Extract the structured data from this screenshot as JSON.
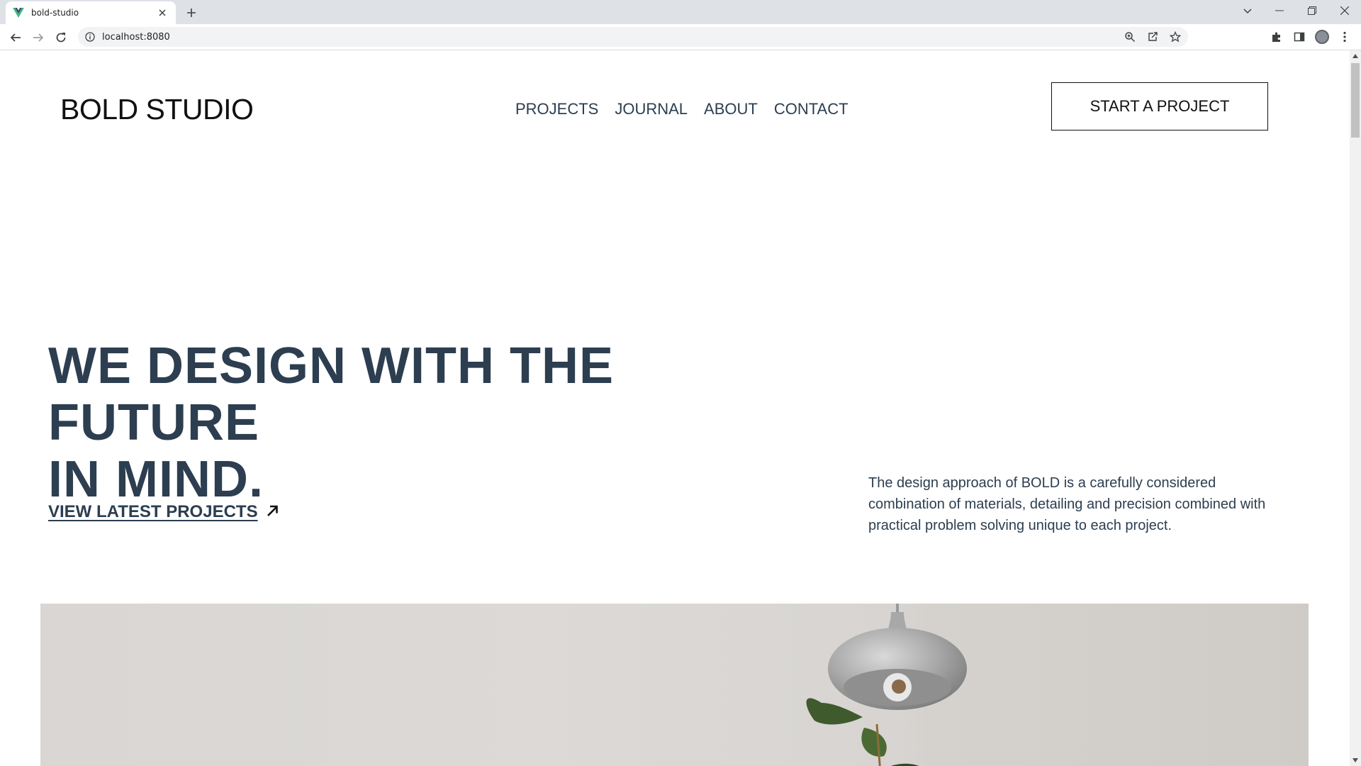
{
  "browser": {
    "tab_title": "bold-studio",
    "url": "localhost:8080",
    "icons": [
      "vue-favicon",
      "close-icon",
      "plus-icon",
      "chevron-down-icon",
      "minimize-icon",
      "restore-icon",
      "back-arrow-icon",
      "forward-arrow-icon",
      "reload-icon",
      "info-icon",
      "zoom-icon",
      "share-icon",
      "star-icon",
      "extensions-icon",
      "sidepanel-icon",
      "profile-avatar",
      "kebab-menu-icon"
    ]
  },
  "site": {
    "logo": "BOLD STUDIO",
    "nav": [
      "PROJECTS",
      "JOURNAL",
      "ABOUT",
      "CONTACT"
    ],
    "cta_label": "START A PROJECT"
  },
  "hero": {
    "title_line1": "WE DESIGN WITH THE FUTURE",
    "title_line2": "IN MIND.",
    "link_label": "VIEW LATEST PROJECTS",
    "description": "The design approach of BOLD is a carefully considered combination of materials, detailing and precision combined with practical problem solving unique to each project."
  },
  "colors": {
    "text_primary": "#2c3e50",
    "logo": "#111111",
    "chrome_bg": "#dee1e6",
    "vue_green": "#41b883",
    "vue_dark": "#35495e"
  }
}
